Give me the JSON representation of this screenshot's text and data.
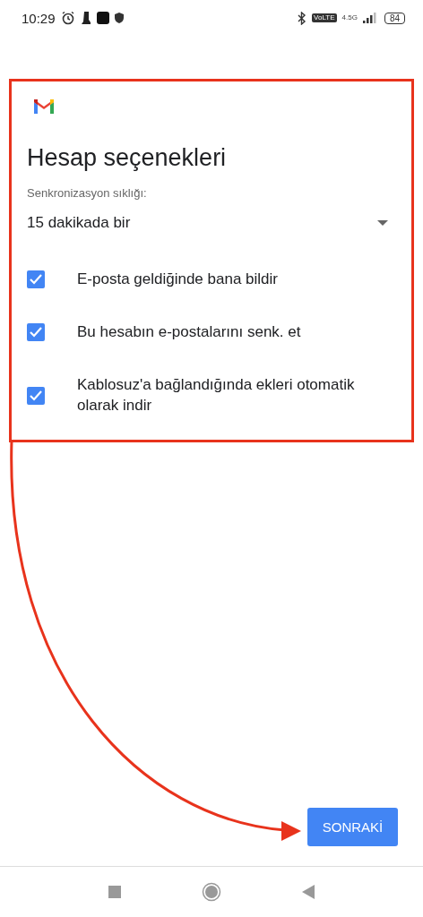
{
  "status_bar": {
    "time": "10:29",
    "network": "4.5G",
    "volte": "VoLTE",
    "battery": "84"
  },
  "card": {
    "title": "Hesap seçenekleri",
    "sync_label": "Senkronizasyon sıklığı:",
    "sync_value": "15 dakikada bir",
    "options": [
      {
        "label": "E-posta geldiğinde bana bildir",
        "checked": true
      },
      {
        "label": "Bu hesabın e-postalarını senk. et",
        "checked": true
      },
      {
        "label": "Kablosuz'a bağlandığında ekleri otomatik olarak indir",
        "checked": true
      }
    ]
  },
  "next_button": "SONRAKİ"
}
